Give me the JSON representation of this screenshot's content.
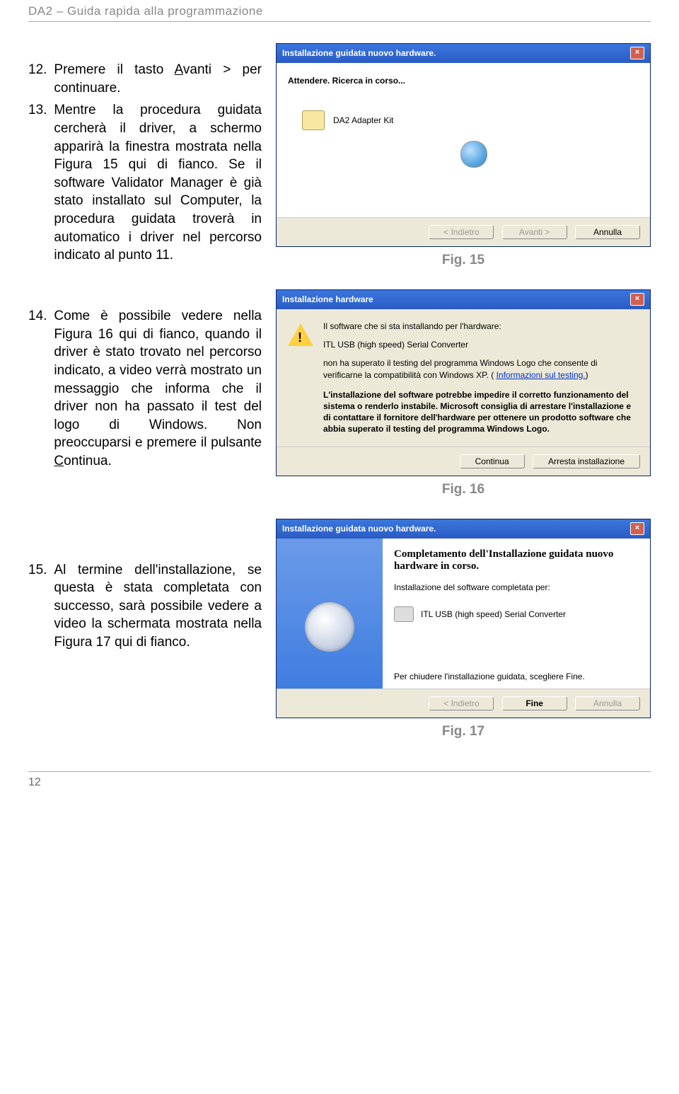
{
  "header": "DA2  – Guida rapida alla programmazione",
  "step12": {
    "num": "12.",
    "text_a": "Premere il tasto ",
    "underline": "A",
    "text_b": "vanti > per continuare."
  },
  "step13": {
    "num": "13.",
    "text": "Mentre la procedura guidata cercherà il driver, a schermo apparirà la finestra mostrata nella Figura 15 qui di fianco. Se il software Validator Manager è già stato installato sul Computer, la procedura guidata troverà in automatico i driver nel percorso indicato al punto 11."
  },
  "fig15": "Fig. 15",
  "step14": {
    "num": "14.",
    "text_a": "Come è possibile vedere nella Figura 16 qui di fianco, quando il driver è stato trovato nel percorso indicato, a video verrà mostrato un messaggio che informa che il driver non ha passato il test del logo di Windows. Non preoccuparsi e premere il pulsante ",
    "underline": "C",
    "text_b": "ontinua."
  },
  "fig16": "Fig. 16",
  "step15": {
    "num": "15.",
    "text": "Al termine dell'installazione, se questa è stata completata con successo, sarà possibile vedere a video la schermata mostrata nella Figura 17 qui di fianco."
  },
  "fig17": "Fig. 17",
  "page_number": "12",
  "wiz1": {
    "title": "Installazione guidata nuovo hardware.",
    "busy": "Attendere. Ricerca in corso...",
    "device": "DA2 Adapter Kit",
    "back": "< Indietro",
    "next": "Avanti >",
    "cancel": "Annulla"
  },
  "dlg2": {
    "title": "Installazione hardware",
    "line1": "Il software che si sta installando per l'hardware:",
    "device": "ITL USB (high speed) Serial Converter",
    "line2a": "non ha superato il testing del programma Windows Logo che consente di verificarne la compatibilità con Windows XP. (",
    "link": "Informazioni sul testing.",
    "line2b": ")",
    "bold": "L'installazione del software potrebbe impedire il corretto funzionamento del sistema o renderlo instabile. Microsoft consiglia di arrestare l'installazione e di contattare il fornitore dell'hardware per ottenere un prodotto software che abbia superato il testing del programma Windows Logo.",
    "continue": "Continua",
    "stop": "Arresta installazione"
  },
  "wiz3": {
    "title": "Installazione guidata nuovo hardware.",
    "heading": "Completamento dell'Installazione guidata nuovo hardware in corso.",
    "sub": "Installazione del software completata per:",
    "device": "ITL USB (high speed) Serial Converter",
    "hint": "Per chiudere l'installazione guidata, scegliere Fine.",
    "back": "< Indietro",
    "finish": "Fine",
    "cancel": "Annulla"
  }
}
